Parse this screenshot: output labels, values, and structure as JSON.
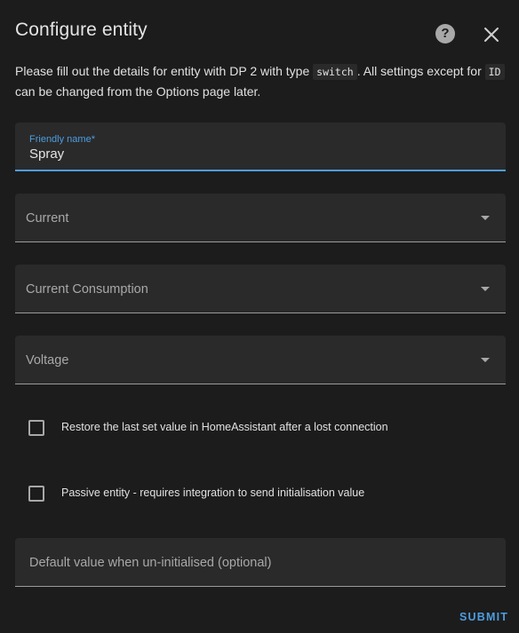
{
  "dialog": {
    "title": "Configure entity",
    "description": {
      "part1": "Please fill out the details for entity with DP 2 with type ",
      "code1": "switch",
      "part2": ". All settings except for ",
      "code2": "ID",
      "part3": " can be changed from the Options page later."
    },
    "icons": {
      "help": "help-circle-icon",
      "close": "close-icon"
    }
  },
  "form": {
    "friendly_name": {
      "label": "Friendly name*",
      "value": "Spray"
    },
    "current": {
      "label": "Current"
    },
    "current_consumption": {
      "label": "Current Consumption"
    },
    "voltage": {
      "label": "Voltage"
    },
    "restore_checkbox": {
      "label": "Restore the last set value in HomeAssistant after a lost connection",
      "checked": false
    },
    "passive_checkbox": {
      "label": "Passive entity - requires integration to send initialisation value",
      "checked": false
    },
    "default_value": {
      "label": "Default value when un-initialised (optional)"
    },
    "submit_label": "SUBMIT"
  },
  "colors": {
    "background": "#1c1c1c",
    "field_bg": "#2a2a2a",
    "accent": "#4d9de0"
  }
}
